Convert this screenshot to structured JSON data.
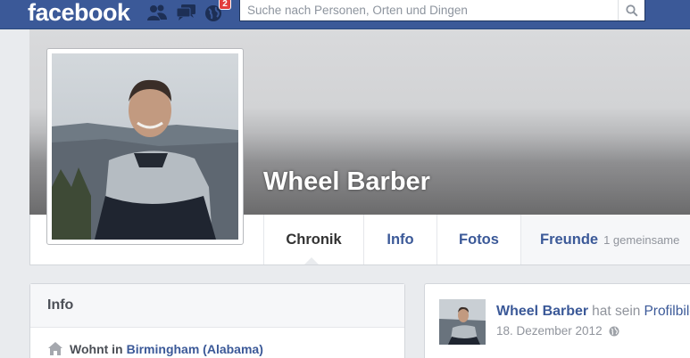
{
  "header": {
    "logo": "facebook",
    "notification_count": "2",
    "search": {
      "placeholder": "Suche nach Personen, Orten und Dingen"
    },
    "icons": [
      "friend-requests-icon",
      "messages-icon",
      "notifications-globe-icon",
      "magnifier-icon"
    ],
    "colors": {
      "bar": "#3b5998",
      "badge": "#e23d3d"
    }
  },
  "profile": {
    "name": "Wheel Barber"
  },
  "nav": {
    "tabs": [
      {
        "label": "Chronik",
        "active": true
      },
      {
        "label": "Info",
        "active": false
      },
      {
        "label": "Fotos",
        "active": false
      }
    ],
    "friends": {
      "label": "Freunde",
      "sub": "1 gemeinsame"
    }
  },
  "info_card": {
    "title": "Info",
    "lives_in_prefix": "Wohnt in",
    "lives_in_place": "Birmingham (Alabama)",
    "icon": "house-icon"
  },
  "post": {
    "author": "Wheel Barber",
    "action": "hat sein",
    "target": "Profilbild",
    "date": "18. Dezember 2012",
    "audience_icon": "globe-icon"
  }
}
